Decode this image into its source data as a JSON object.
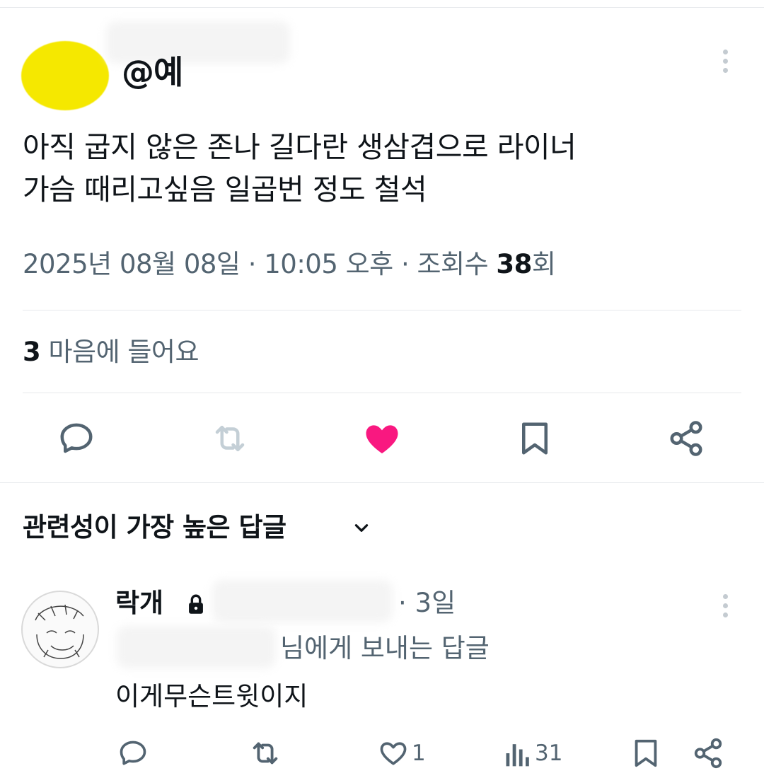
{
  "tweet": {
    "handle": "@예",
    "text_line1": "아직 굽지 않은 존나 길다란 생삼겹으로 라이너",
    "text_line2": "가슴 때리고싶음 일곱번 정도 철석",
    "meta_prefix": "2025년 08월 08일 · 10:05 오후 · 조회수 ",
    "views_count": "38",
    "views_suffix": "회",
    "likes_count": "3",
    "likes_label": " 마음에 들어요",
    "liked": true
  },
  "actions": {
    "reply_icon": "comment-icon",
    "retweet_icon": "retweet-icon",
    "like_icon": "heart-filled-icon",
    "bookmark_icon": "bookmark-icon",
    "share_icon": "share-icon"
  },
  "replies_header": {
    "sort_label": "관련성이 가장 높은 답글",
    "sort_icon": "chevron-down-icon"
  },
  "reply": {
    "name": "락개",
    "time": "· 3일",
    "replying_to": "님에게 보내는 답글",
    "text": "이게무슨트윗이지",
    "like_count": "1",
    "view_count": "31"
  },
  "colors": {
    "like_active": "#f91880",
    "icon_gray": "#536471",
    "disabled_icon": "#c4cfd6",
    "avatar_yellow": "#f5e800"
  }
}
